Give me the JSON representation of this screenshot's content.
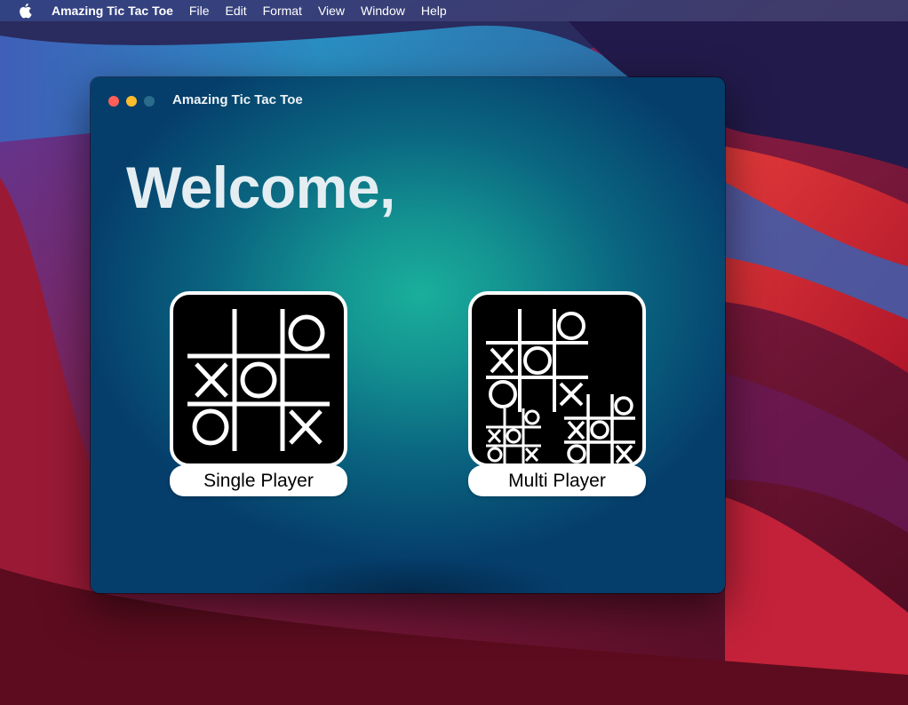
{
  "menubar": {
    "app_name": "Amazing Tic Tac Toe",
    "items": [
      "File",
      "Edit",
      "Format",
      "View",
      "Window",
      "Help"
    ]
  },
  "window": {
    "title": "Amazing Tic Tac Toe",
    "heading": "Welcome,"
  },
  "modes": {
    "single": {
      "label": "Single Player",
      "icon": "tic-tac-toe-board-icon"
    },
    "multi": {
      "label": "Multi Player",
      "icon": "multiple-boards-icon"
    }
  },
  "colors": {
    "close": "#ff5f57",
    "minimize": "#febc2e",
    "zoom_inactive": "#2a6c8a",
    "window_center": "#1aaf9b",
    "window_edge": "#053e6b"
  }
}
